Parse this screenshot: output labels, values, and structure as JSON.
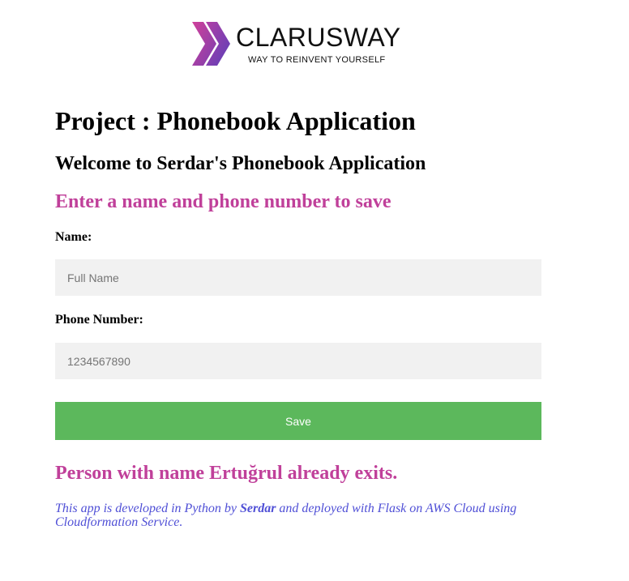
{
  "logo": {
    "name": "CLARUSWAY",
    "tagline": "WAY TO REINVENT YOURSELF",
    "icon": "chevron-arrows-logo"
  },
  "page": {
    "title": "Project : Phonebook Application",
    "welcome": "Welcome to Serdar's Phonebook Application",
    "prompt": "Enter a name and phone number to save"
  },
  "form": {
    "name_label": "Name:",
    "name_placeholder": "Full Name",
    "phone_label": "Phone Number:",
    "phone_placeholder": "1234567890",
    "save_label": "Save"
  },
  "result": {
    "message": "Person with name Ertuğrul already exits."
  },
  "footer": {
    "before": "This app is developed in Python by ",
    "author": "Serdar",
    "after": " and deployed with Flask on AWS Cloud using Cloudformation Service."
  },
  "colors": {
    "accent": "#c0409a",
    "save_button": "#5cb85c",
    "footer_text": "#4f4fd6",
    "input_bg": "#f1f1f1"
  }
}
